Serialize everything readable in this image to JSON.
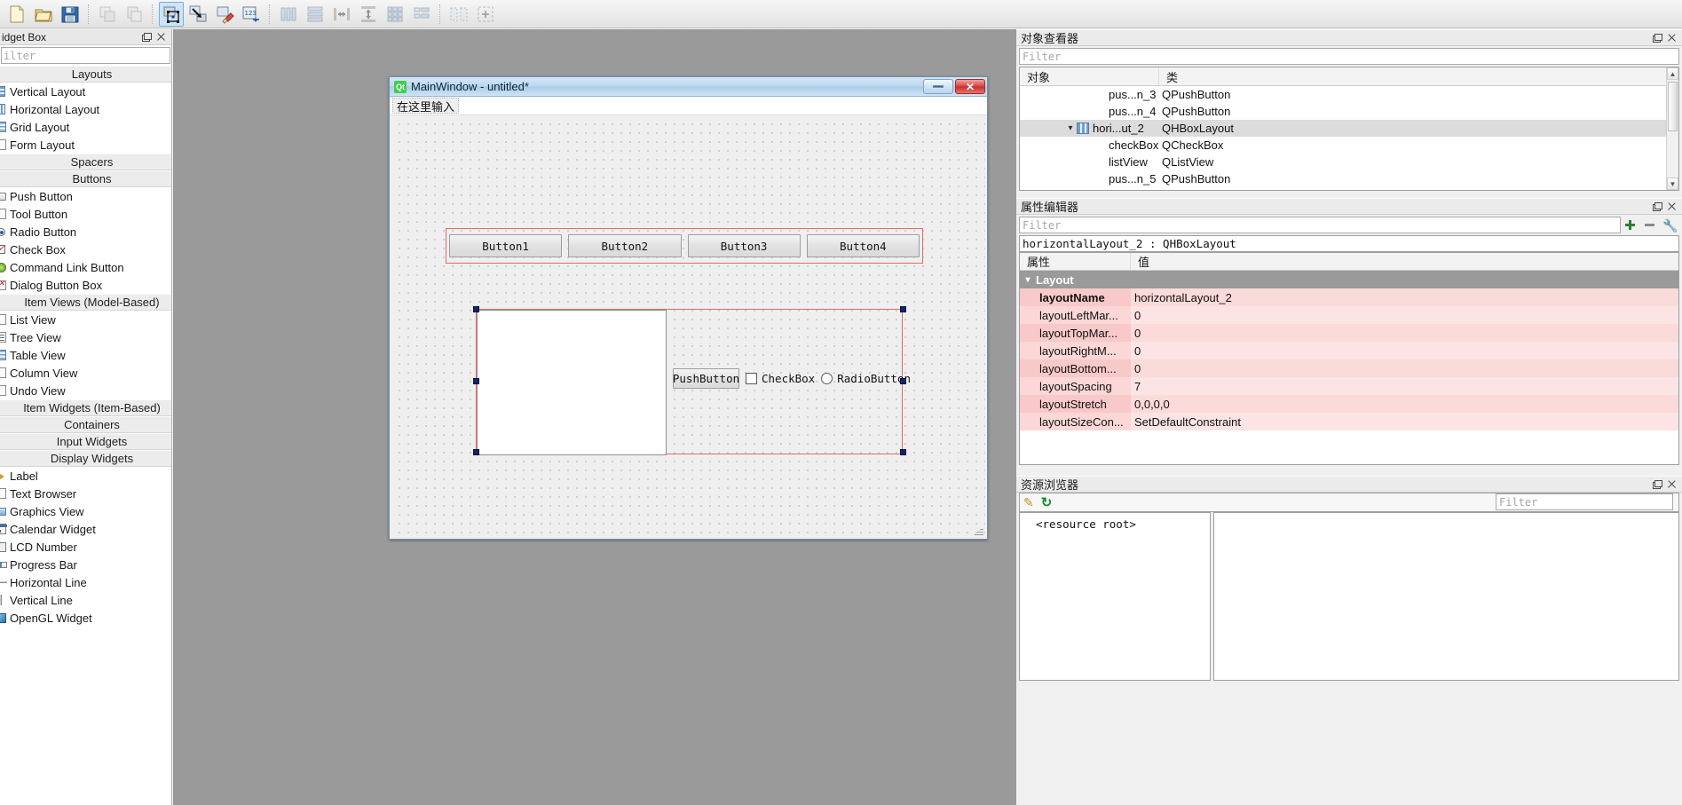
{
  "toolbar": {
    "buttons": [
      {
        "name": "new-file-icon",
        "label": "New",
        "state": "enabled"
      },
      {
        "name": "open-file-icon",
        "label": "Open",
        "state": "enabled"
      },
      {
        "name": "save-file-icon",
        "label": "Save",
        "state": "enabled"
      },
      {
        "name": "copy-icon",
        "label": "Copy",
        "state": "disabled"
      },
      {
        "name": "paste-icon",
        "label": "Paste",
        "state": "disabled"
      },
      {
        "name": "edit-widgets-icon",
        "label": "Edit Widgets",
        "state": "active"
      },
      {
        "name": "edit-signals-slots-icon",
        "label": "Edit Signals/Slots",
        "state": "enabled"
      },
      {
        "name": "edit-buddies-icon",
        "label": "Edit Buddies",
        "state": "enabled"
      },
      {
        "name": "edit-tab-order-icon",
        "label": "Edit Tab Order",
        "state": "enabled"
      },
      {
        "name": "layout-vertically-icon",
        "label": "Lay Out Vertically",
        "state": "disabled"
      },
      {
        "name": "layout-horizontally-icon",
        "label": "Lay Out Horizontally",
        "state": "disabled"
      },
      {
        "name": "layout-splitter-horizontal-icon",
        "label": "Lay Out Horizontally in Splitter",
        "state": "disabled"
      },
      {
        "name": "layout-splitter-vertical-icon",
        "label": "Lay Out Vertically in Splitter",
        "state": "disabled"
      },
      {
        "name": "layout-grid-icon",
        "label": "Lay Out in a Grid",
        "state": "disabled"
      },
      {
        "name": "layout-form-icon",
        "label": "Lay Out in a Form Layout",
        "state": "disabled"
      },
      {
        "name": "break-layout-icon",
        "label": "Break Layout",
        "state": "disabled"
      },
      {
        "name": "adjust-size-icon",
        "label": "Adjust Size",
        "state": "disabled"
      }
    ]
  },
  "widget_box": {
    "title": "Widget Box",
    "title_clipped": "idget Box",
    "filter_placeholder": "Filter",
    "filter_clipped": "ilter",
    "groups": [
      {
        "label": "Layouts",
        "items": [
          {
            "label": "Vertical Layout",
            "icon": "vertical-layout-icon"
          },
          {
            "label": "Horizontal Layout",
            "icon": "horizontal-layout-icon"
          },
          {
            "label": "Grid Layout",
            "icon": "grid-layout-icon"
          },
          {
            "label": "Form Layout",
            "icon": "form-layout-icon"
          }
        ]
      },
      {
        "label": "Spacers",
        "items": []
      },
      {
        "label": "Buttons",
        "items": [
          {
            "label": "Push Button",
            "icon": "push-button-icon"
          },
          {
            "label": "Tool Button",
            "icon": "tool-button-icon"
          },
          {
            "label": "Radio Button",
            "icon": "radio-button-icon"
          },
          {
            "label": "Check Box",
            "icon": "check-box-icon"
          },
          {
            "label": "Command Link Button",
            "icon": "command-link-button-icon"
          },
          {
            "label": "Dialog Button Box",
            "icon": "dialog-button-box-icon"
          }
        ]
      },
      {
        "label": "Item Views (Model-Based)",
        "items": [
          {
            "label": "List View",
            "icon": "list-view-icon"
          },
          {
            "label": "Tree View",
            "icon": "tree-view-icon"
          },
          {
            "label": "Table View",
            "icon": "table-view-icon"
          },
          {
            "label": "Column View",
            "icon": "column-view-icon"
          },
          {
            "label": "Undo View",
            "icon": "undo-view-icon"
          }
        ]
      },
      {
        "label": "Item Widgets (Item-Based)",
        "items": []
      },
      {
        "label": "Containers",
        "items": []
      },
      {
        "label": "Input Widgets",
        "items": []
      },
      {
        "label": "Display Widgets",
        "items": [
          {
            "label": "Label",
            "icon": "label-icon"
          },
          {
            "label": "Text Browser",
            "icon": "text-browser-icon"
          },
          {
            "label": "Graphics View",
            "icon": "graphics-view-icon"
          },
          {
            "label": "Calendar Widget",
            "icon": "calendar-widget-icon"
          },
          {
            "label": "LCD Number",
            "icon": "lcd-number-icon"
          },
          {
            "label": "Progress Bar",
            "icon": "progress-bar-icon"
          },
          {
            "label": "Horizontal Line",
            "icon": "horizontal-line-icon"
          },
          {
            "label": "Vertical Line",
            "icon": "vertical-line-icon"
          },
          {
            "label": "OpenGL Widget",
            "icon": "opengl-widget-icon"
          }
        ]
      }
    ]
  },
  "form": {
    "title": "MainWindow - untitled*",
    "logo_text": "Qt",
    "minimize_label": "",
    "close_label": "✕",
    "menubar": [
      {
        "label": "在这里输入"
      }
    ],
    "top_row_buttons": [
      "Button1",
      "Button2",
      "Button3",
      "Button4"
    ],
    "selected_row": {
      "push_button": "PushButton",
      "check_box": "CheckBox",
      "radio_button": "RadioButton"
    }
  },
  "object_inspector": {
    "title": "对象查看器",
    "filter_placeholder": "Filter",
    "columns": [
      "对象",
      "类"
    ],
    "rows": [
      {
        "name": "pus...n_3",
        "class": "QPushButton",
        "depth": 3,
        "expandable": false,
        "selected": false,
        "icon": ""
      },
      {
        "name": "pus...n_4",
        "class": "QPushButton",
        "depth": 3,
        "expandable": false,
        "selected": false,
        "icon": ""
      },
      {
        "name": "hori...ut_2",
        "class": "QHBoxLayout",
        "depth": 2,
        "expandable": true,
        "selected": true,
        "icon": "hbox-layout-icon"
      },
      {
        "name": "checkBox",
        "class": "QCheckBox",
        "depth": 3,
        "expandable": false,
        "selected": false,
        "icon": ""
      },
      {
        "name": "listView",
        "class": "QListView",
        "depth": 3,
        "expandable": false,
        "selected": false,
        "icon": ""
      },
      {
        "name": "pus...n_5",
        "class": "QPushButton",
        "depth": 3,
        "expandable": false,
        "selected": false,
        "icon": ""
      }
    ]
  },
  "property_editor": {
    "title": "属性编辑器",
    "filter_placeholder": "Filter",
    "object_header": "horizontalLayout_2 : QHBoxLayout",
    "columns": [
      "属性",
      "值"
    ],
    "group_label": "Layout",
    "rows": [
      {
        "key": "layoutName",
        "value": "horizontalLayout_2",
        "bold": true
      },
      {
        "key": "layoutLeftMar...",
        "value": "0",
        "bold": false
      },
      {
        "key": "layoutTopMar...",
        "value": "0",
        "bold": false
      },
      {
        "key": "layoutRightM...",
        "value": "0",
        "bold": false
      },
      {
        "key": "layoutBottom...",
        "value": "0",
        "bold": false
      },
      {
        "key": "layoutSpacing",
        "value": "7",
        "bold": false
      },
      {
        "key": "layoutStretch",
        "value": "0,0,0,0",
        "bold": false
      },
      {
        "key": "layoutSizeCon...",
        "value": "SetDefaultConstraint",
        "bold": false
      }
    ],
    "tools": [
      {
        "name": "add-property-button",
        "glyph": "+"
      },
      {
        "name": "remove-property-button",
        "glyph": "−"
      },
      {
        "name": "configure-property-button",
        "glyph": "🔧"
      }
    ]
  },
  "resource_browser": {
    "title": "资源浏览器",
    "edit_icon": "pencil-icon",
    "reload_icon": "reload-icon",
    "filter_placeholder": "Filter",
    "root_label": "<resource root>"
  },
  "colors": {
    "selection_handle": "#12246b",
    "layout_outline": "#e06b6b",
    "property_row_bg": "#fbd7d7",
    "property_group_bg": "#9a9a9a",
    "accent_active_toolbar": "#cde4f7",
    "canvas_bg": "#9a9a9a",
    "qt_logo_green": "#41cd52",
    "close_button_red": "#c52f2a"
  }
}
